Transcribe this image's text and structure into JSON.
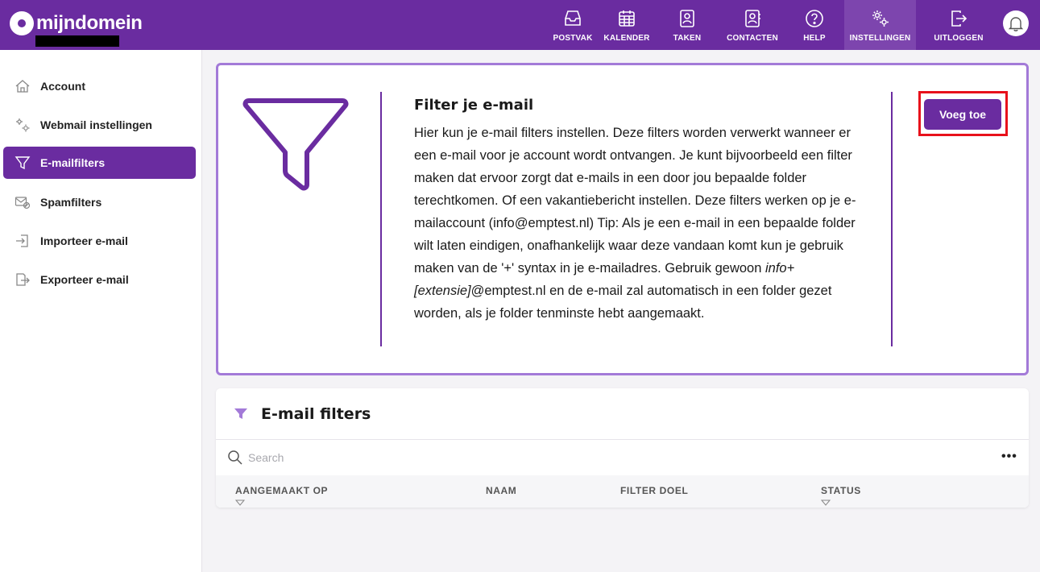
{
  "brand": {
    "name": "mijndomein"
  },
  "nav": [
    {
      "label": "POSTVAK",
      "icon": "inbox-icon"
    },
    {
      "label": "KALENDER",
      "icon": "calendar-icon"
    },
    {
      "label": "TAKEN",
      "icon": "tasks-icon"
    },
    {
      "label": "CONTACTEN",
      "icon": "contacts-icon"
    },
    {
      "label": "HELP",
      "icon": "help-icon"
    },
    {
      "label": "INSTELLINGEN",
      "icon": "settings-icon",
      "active": true
    },
    {
      "label": "UITLOGGEN",
      "icon": "logout-icon"
    }
  ],
  "sidebar": {
    "items": [
      {
        "label": "Account",
        "icon": "home-icon"
      },
      {
        "label": "Webmail instellingen",
        "icon": "gears-icon"
      },
      {
        "label": "E-mailfilters",
        "icon": "funnel-icon",
        "active": true
      },
      {
        "label": "Spamfilters",
        "icon": "spam-filter-icon"
      },
      {
        "label": "Importeer e-mail",
        "icon": "import-icon"
      },
      {
        "label": "Exporteer e-mail",
        "icon": "export-icon"
      }
    ]
  },
  "info": {
    "title": "Filter je e-mail",
    "body_part1": "Hier kun je e-mail filters instellen. Deze filters worden verwerkt wanneer er een e-mail voor je account wordt ontvangen. Je kunt bijvoorbeeld een filter maken dat ervoor zorgt dat e-mails in een door jou bepaalde folder terechtkomen. Of een vakantiebericht instellen. Deze filters werken op je e-mailaccount (info@emptest.nl) Tip: Als je een e-mail in een bepaalde folder wilt laten eindigen, onafhankelijk waar deze vandaan komt kun je gebruik maken van de '+' syntax in je e-mailadres. Gebruik gewoon",
    "body_italic": "info+[extensie]",
    "body_part2": "@emptest.nl en de e-mail zal automatisch in een folder gezet worden, als je folder tenminste hebt aangemaakt.",
    "add_button": "Voeg toe"
  },
  "filters": {
    "title": "E-mail filters",
    "search_placeholder": "Search",
    "more_label": "•••",
    "columns": [
      "AANGEMAAKT OP",
      "NAAM",
      "FILTER DOEL",
      "STATUS"
    ]
  },
  "colors": {
    "brand": "#6a2ca0",
    "card_border": "#a37ad8",
    "highlight": "#e8111b"
  }
}
